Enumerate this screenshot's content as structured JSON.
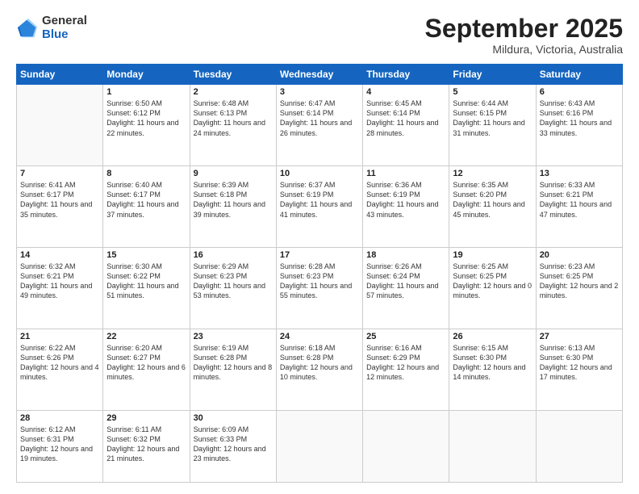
{
  "logo": {
    "general": "General",
    "blue": "Blue"
  },
  "title": "September 2025",
  "location": "Mildura, Victoria, Australia",
  "weekdays": [
    "Sunday",
    "Monday",
    "Tuesday",
    "Wednesday",
    "Thursday",
    "Friday",
    "Saturday"
  ],
  "weeks": [
    [
      {
        "day": "",
        "sunrise": "",
        "sunset": "",
        "daylight": ""
      },
      {
        "day": "1",
        "sunrise": "Sunrise: 6:50 AM",
        "sunset": "Sunset: 6:12 PM",
        "daylight": "Daylight: 11 hours and 22 minutes."
      },
      {
        "day": "2",
        "sunrise": "Sunrise: 6:48 AM",
        "sunset": "Sunset: 6:13 PM",
        "daylight": "Daylight: 11 hours and 24 minutes."
      },
      {
        "day": "3",
        "sunrise": "Sunrise: 6:47 AM",
        "sunset": "Sunset: 6:14 PM",
        "daylight": "Daylight: 11 hours and 26 minutes."
      },
      {
        "day": "4",
        "sunrise": "Sunrise: 6:45 AM",
        "sunset": "Sunset: 6:14 PM",
        "daylight": "Daylight: 11 hours and 28 minutes."
      },
      {
        "day": "5",
        "sunrise": "Sunrise: 6:44 AM",
        "sunset": "Sunset: 6:15 PM",
        "daylight": "Daylight: 11 hours and 31 minutes."
      },
      {
        "day": "6",
        "sunrise": "Sunrise: 6:43 AM",
        "sunset": "Sunset: 6:16 PM",
        "daylight": "Daylight: 11 hours and 33 minutes."
      }
    ],
    [
      {
        "day": "7",
        "sunrise": "Sunrise: 6:41 AM",
        "sunset": "Sunset: 6:17 PM",
        "daylight": "Daylight: 11 hours and 35 minutes."
      },
      {
        "day": "8",
        "sunrise": "Sunrise: 6:40 AM",
        "sunset": "Sunset: 6:17 PM",
        "daylight": "Daylight: 11 hours and 37 minutes."
      },
      {
        "day": "9",
        "sunrise": "Sunrise: 6:39 AM",
        "sunset": "Sunset: 6:18 PM",
        "daylight": "Daylight: 11 hours and 39 minutes."
      },
      {
        "day": "10",
        "sunrise": "Sunrise: 6:37 AM",
        "sunset": "Sunset: 6:19 PM",
        "daylight": "Daylight: 11 hours and 41 minutes."
      },
      {
        "day": "11",
        "sunrise": "Sunrise: 6:36 AM",
        "sunset": "Sunset: 6:19 PM",
        "daylight": "Daylight: 11 hours and 43 minutes."
      },
      {
        "day": "12",
        "sunrise": "Sunrise: 6:35 AM",
        "sunset": "Sunset: 6:20 PM",
        "daylight": "Daylight: 11 hours and 45 minutes."
      },
      {
        "day": "13",
        "sunrise": "Sunrise: 6:33 AM",
        "sunset": "Sunset: 6:21 PM",
        "daylight": "Daylight: 11 hours and 47 minutes."
      }
    ],
    [
      {
        "day": "14",
        "sunrise": "Sunrise: 6:32 AM",
        "sunset": "Sunset: 6:21 PM",
        "daylight": "Daylight: 11 hours and 49 minutes."
      },
      {
        "day": "15",
        "sunrise": "Sunrise: 6:30 AM",
        "sunset": "Sunset: 6:22 PM",
        "daylight": "Daylight: 11 hours and 51 minutes."
      },
      {
        "day": "16",
        "sunrise": "Sunrise: 6:29 AM",
        "sunset": "Sunset: 6:23 PM",
        "daylight": "Daylight: 11 hours and 53 minutes."
      },
      {
        "day": "17",
        "sunrise": "Sunrise: 6:28 AM",
        "sunset": "Sunset: 6:23 PM",
        "daylight": "Daylight: 11 hours and 55 minutes."
      },
      {
        "day": "18",
        "sunrise": "Sunrise: 6:26 AM",
        "sunset": "Sunset: 6:24 PM",
        "daylight": "Daylight: 11 hours and 57 minutes."
      },
      {
        "day": "19",
        "sunrise": "Sunrise: 6:25 AM",
        "sunset": "Sunset: 6:25 PM",
        "daylight": "Daylight: 12 hours and 0 minutes."
      },
      {
        "day": "20",
        "sunrise": "Sunrise: 6:23 AM",
        "sunset": "Sunset: 6:25 PM",
        "daylight": "Daylight: 12 hours and 2 minutes."
      }
    ],
    [
      {
        "day": "21",
        "sunrise": "Sunrise: 6:22 AM",
        "sunset": "Sunset: 6:26 PM",
        "daylight": "Daylight: 12 hours and 4 minutes."
      },
      {
        "day": "22",
        "sunrise": "Sunrise: 6:20 AM",
        "sunset": "Sunset: 6:27 PM",
        "daylight": "Daylight: 12 hours and 6 minutes."
      },
      {
        "day": "23",
        "sunrise": "Sunrise: 6:19 AM",
        "sunset": "Sunset: 6:28 PM",
        "daylight": "Daylight: 12 hours and 8 minutes."
      },
      {
        "day": "24",
        "sunrise": "Sunrise: 6:18 AM",
        "sunset": "Sunset: 6:28 PM",
        "daylight": "Daylight: 12 hours and 10 minutes."
      },
      {
        "day": "25",
        "sunrise": "Sunrise: 6:16 AM",
        "sunset": "Sunset: 6:29 PM",
        "daylight": "Daylight: 12 hours and 12 minutes."
      },
      {
        "day": "26",
        "sunrise": "Sunrise: 6:15 AM",
        "sunset": "Sunset: 6:30 PM",
        "daylight": "Daylight: 12 hours and 14 minutes."
      },
      {
        "day": "27",
        "sunrise": "Sunrise: 6:13 AM",
        "sunset": "Sunset: 6:30 PM",
        "daylight": "Daylight: 12 hours and 17 minutes."
      }
    ],
    [
      {
        "day": "28",
        "sunrise": "Sunrise: 6:12 AM",
        "sunset": "Sunset: 6:31 PM",
        "daylight": "Daylight: 12 hours and 19 minutes."
      },
      {
        "day": "29",
        "sunrise": "Sunrise: 6:11 AM",
        "sunset": "Sunset: 6:32 PM",
        "daylight": "Daylight: 12 hours and 21 minutes."
      },
      {
        "day": "30",
        "sunrise": "Sunrise: 6:09 AM",
        "sunset": "Sunset: 6:33 PM",
        "daylight": "Daylight: 12 hours and 23 minutes."
      },
      {
        "day": "",
        "sunrise": "",
        "sunset": "",
        "daylight": ""
      },
      {
        "day": "",
        "sunrise": "",
        "sunset": "",
        "daylight": ""
      },
      {
        "day": "",
        "sunrise": "",
        "sunset": "",
        "daylight": ""
      },
      {
        "day": "",
        "sunrise": "",
        "sunset": "",
        "daylight": ""
      }
    ]
  ]
}
